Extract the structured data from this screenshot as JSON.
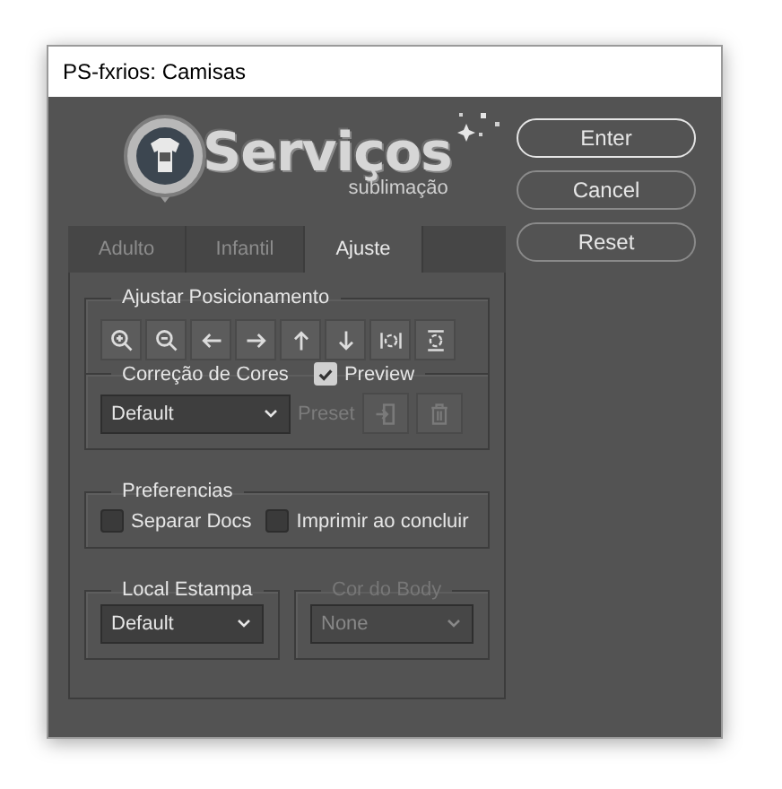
{
  "window": {
    "title": "PS-fxrios: Camisas"
  },
  "logo": {
    "title": "Serviços",
    "subtitle": "sublimação"
  },
  "buttons": [
    {
      "label": "Enter",
      "default": true
    },
    {
      "label": "Cancel",
      "default": false
    },
    {
      "label": "Reset",
      "default": false
    }
  ],
  "tabs": [
    {
      "label": "Adulto",
      "selected": false
    },
    {
      "label": "Infantil",
      "selected": false
    },
    {
      "label": "Ajuste",
      "selected": true
    }
  ],
  "position_group": {
    "title": "Ajustar Posicionamento",
    "tools": [
      {
        "kind": "zoom-in"
      },
      {
        "kind": "zoom-out"
      },
      {
        "kind": "left"
      },
      {
        "kind": "right"
      },
      {
        "kind": "up"
      },
      {
        "kind": "down"
      },
      {
        "kind": "fit-width"
      },
      {
        "kind": "fit-height"
      }
    ]
  },
  "color_group": {
    "title": "Correção de Cores",
    "preview": {
      "label": "Preview",
      "checked": true
    },
    "preset_select": {
      "value": "Default"
    },
    "preset_label": "Preset",
    "preset_actions_disabled": true
  },
  "preferences": {
    "title": "Preferencias",
    "checkboxes": [
      {
        "label": "Separar Docs",
        "checked": false
      },
      {
        "label": "Imprimir ao concluir",
        "checked": false
      }
    ]
  },
  "local_estampa": {
    "title": "Local Estampa",
    "value": "Default",
    "disabled": false
  },
  "cor_do_body": {
    "title": "Cor do Body",
    "value": "None",
    "disabled": true
  }
}
